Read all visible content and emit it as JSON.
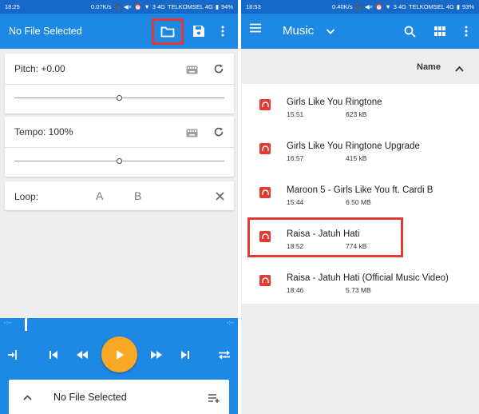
{
  "left": {
    "status": {
      "time": "18:25",
      "speed": "0.07K/s",
      "network": "3 4G",
      "carrier": "TELKOMSEL 4G",
      "battery": "94%"
    },
    "appbar": {
      "title": "No File Selected",
      "folder_icon": "folder-icon",
      "save_icon": "save-icon",
      "more_icon": "more-vert-icon"
    },
    "pitch": {
      "label": "Pitch: +0.00",
      "value": 0.5
    },
    "tempo": {
      "label": "Tempo: 100%",
      "value": 0.5
    },
    "loop": {
      "label": "Loop:",
      "a": "A",
      "b": "B"
    },
    "progress": {
      "start": "-:--",
      "end": "-:--",
      "position": 0.11
    },
    "bottom_sheet": {
      "title": "No File Selected"
    }
  },
  "right": {
    "status": {
      "time": "18:53",
      "speed": "0.40K/s",
      "network": "3 4G",
      "carrier": "TELKOMSEL 4G",
      "battery": "93%"
    },
    "appbar": {
      "title": "Music"
    },
    "sort": {
      "label": "Name"
    },
    "files": [
      {
        "title": "Girls Like You Ringtone",
        "time": "15:51",
        "size": "623 kB"
      },
      {
        "title": "Girls Like You Ringtone Upgrade",
        "time": "16:57",
        "size": "415 kB"
      },
      {
        "title": "Maroon 5 - Girls Like You ft. Cardi B",
        "time": "15:44",
        "size": "6.50 MB"
      },
      {
        "title": "Raisa - Jatuh Hati",
        "time": "18:52",
        "size": "774 kB"
      },
      {
        "title": "Raisa - Jatuh Hati (Official Music Video)",
        "time": "18:46",
        "size": "5.73 MB"
      }
    ]
  },
  "colors": {
    "primary": "#1e88e5",
    "status": "#1669c9",
    "accent": "#f9a825",
    "highlight": "#e53935"
  }
}
